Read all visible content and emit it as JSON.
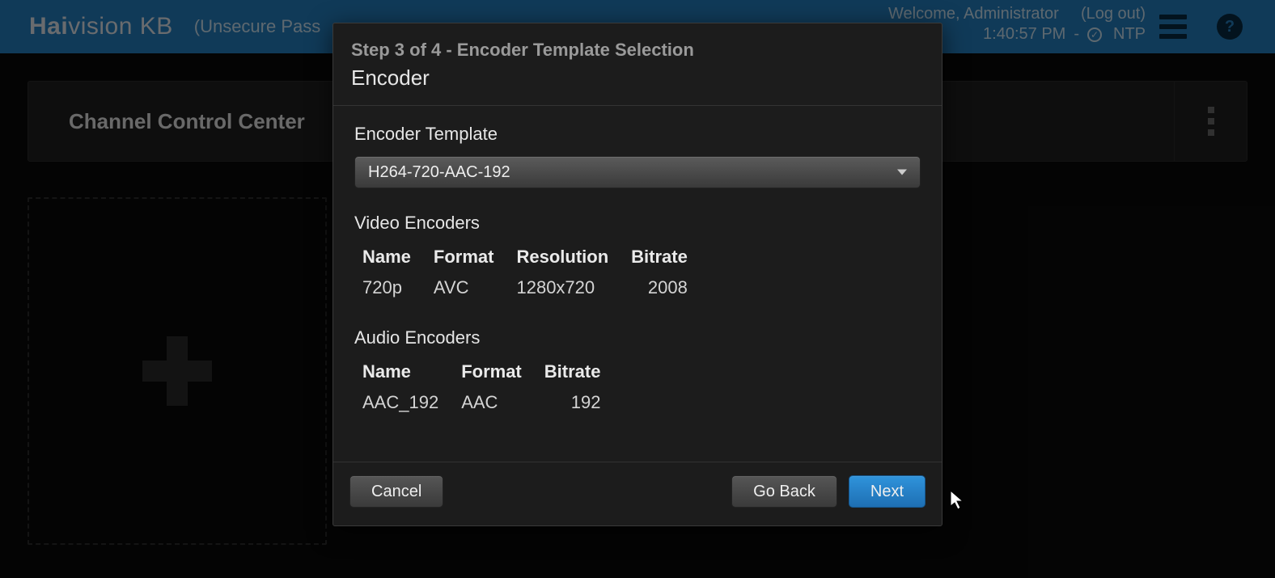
{
  "header": {
    "brand_bold": "Hai",
    "brand_light": "vision KB",
    "unsecure_text": "(Unsecure Pass",
    "welcome": "Welcome, Administrator",
    "logout": "(Log out)",
    "time": "1:40:57 PM",
    "time_sep": "-",
    "ntp_label": "NTP"
  },
  "page": {
    "panel_title": "Channel Control Center"
  },
  "modal": {
    "step_line": "Step 3 of 4 - Encoder Template Selection",
    "title": "Encoder",
    "template_label": "Encoder Template",
    "template_value": "H264-720-AAC-192",
    "video_section": "Video Encoders",
    "video_headers": {
      "name": "Name",
      "format": "Format",
      "resolution": "Resolution",
      "bitrate": "Bitrate"
    },
    "video_rows": [
      {
        "name": "720p",
        "format": "AVC",
        "resolution": "1280x720",
        "bitrate": "2008"
      }
    ],
    "audio_section": "Audio Encoders",
    "audio_headers": {
      "name": "Name",
      "format": "Format",
      "bitrate": "Bitrate"
    },
    "audio_rows": [
      {
        "name": "AAC_192",
        "format": "AAC",
        "bitrate": "192"
      }
    ],
    "buttons": {
      "cancel": "Cancel",
      "back": "Go Back",
      "next": "Next"
    }
  }
}
